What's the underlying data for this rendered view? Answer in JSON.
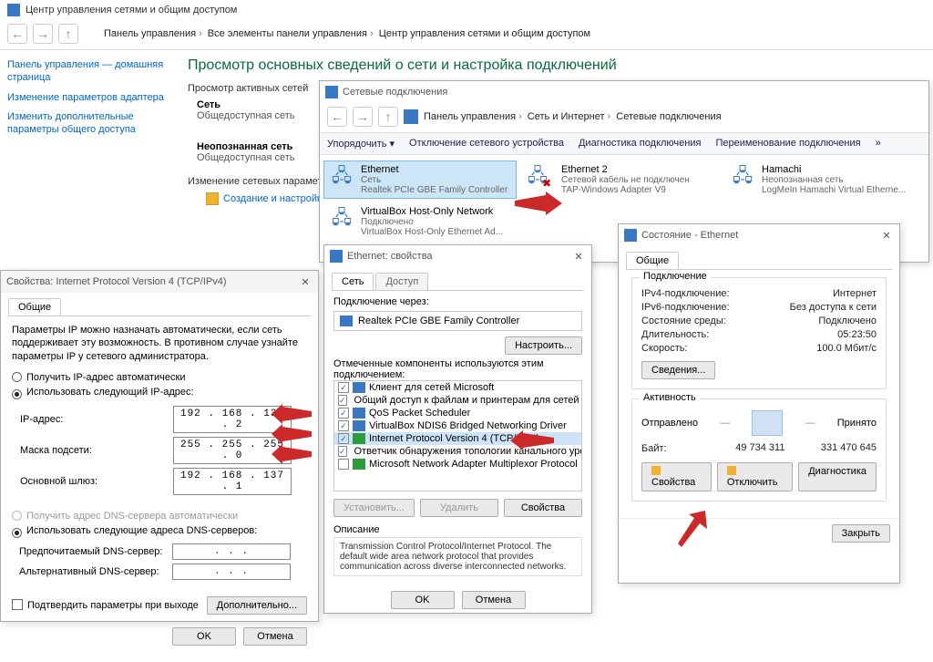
{
  "bg": {
    "title": "Центр управления сетями и общим доступом",
    "crumb1": "Панель управления",
    "crumb2": "Все элементы панели управления",
    "crumb3": "Центр управления сетями и общим доступом",
    "left_links": [
      "Панель управления — домашняя страница",
      "Изменение параметров адаптера",
      "Изменить дополнительные параметры общего доступа"
    ],
    "h2": "Просмотр основных сведений о сети и настройка подключений",
    "sub1": "Просмотр активных сетей",
    "net1_name": "Сеть",
    "net1_kind": "Общедоступная сеть",
    "net2_name": "Неопознанная сеть",
    "net2_kind": "Общедоступная сеть",
    "sub2": "Изменение сетевых параметров",
    "task": "Создание и настройка"
  },
  "nc": {
    "title": "Сетевые подключения",
    "crumb1": "Панель управления",
    "crumb2": "Сеть и Интернет",
    "crumb3": "Сетевые подключения",
    "tb": {
      "organize": "Упорядочить ▾",
      "disable": "Отключение сетевого устройства",
      "diag": "Диагностика подключения",
      "rename": "Переименование подключения",
      "more": "»"
    },
    "a1": {
      "name": "Ethernet",
      "s1": "Сеть",
      "s2": "Realtek PCIe GBE Family Controller"
    },
    "a2": {
      "name": "Ethernet 2",
      "s1": "Сетевой кабель не подключен",
      "s2": "TAP-Windows Adapter V9"
    },
    "a3": {
      "name": "Hamachi",
      "s1": "Неопознанная сеть",
      "s2": "LogMeIn Hamachi Virtual Etherne..."
    },
    "a4": {
      "name": "VirtualBox Host-Only Network",
      "s1": "Подключено",
      "s2": "VirtualBox Host-Only Ethernet Ad..."
    }
  },
  "st": {
    "title": "Состояние - Ethernet",
    "tab1": "Общие",
    "grp1": "Подключение",
    "ipv4_k": "IPv4-подключение:",
    "ipv4_v": "Интернет",
    "ipv6_k": "IPv6-подключение:",
    "ipv6_v": "Без доступа к сети",
    "media_k": "Состояние среды:",
    "media_v": "Подключено",
    "dur_k": "Длительность:",
    "dur_v": "05:23:50",
    "speed_k": "Скорость:",
    "speed_v": "100.0 Мбит/с",
    "details_btn": "Сведения...",
    "grp2": "Активность",
    "sent_lbl": "Отправлено",
    "recv_lbl": "Принято",
    "bytes_k": "Байт:",
    "sent_v": "49 734 311",
    "recv_v": "331 470 645",
    "props_btn": "Свойства",
    "disable_btn": "Отключить",
    "diag_btn": "Диагностика",
    "close_btn": "Закрыть"
  },
  "ep": {
    "title": "Ethernet: свойства",
    "tab_net": "Сеть",
    "tab_access": "Доступ",
    "conn_via": "Подключение через:",
    "adapter": "Realtek PCIe GBE Family Controller",
    "configure": "Настроить...",
    "marked": "Отмеченные компоненты используются этим подключением:",
    "items": [
      "Клиент для сетей Microsoft",
      "Общий доступ к файлам и принтерам для сетей M",
      "QoS Packet Scheduler",
      "VirtualBox NDIS6 Bridged Networking Driver",
      "Internet Protocol Version 4 (TCP/IPv4)",
      "Ответчик обнаружения топологии канального уров",
      "Microsoft Network Adapter Multiplexor Protocol"
    ],
    "install": "Установить...",
    "remove": "Удалить",
    "props": "Свойства",
    "desc_h": "Описание",
    "desc": "Transmission Control Protocol/Internet Protocol. The default wide area network protocol that provides communication across diverse interconnected networks.",
    "ok": "OK",
    "cancel": "Отмена"
  },
  "ip": {
    "title": "Свойства: Internet Protocol Version 4 (TCP/IPv4)",
    "tab": "Общие",
    "intro": "Параметры IP можно назначать автоматически, если сеть поддерживает эту возможность. В противном случае узнайте параметры IP у сетевого администратора.",
    "r_auto": "Получить IP-адрес автоматически",
    "r_manual": "Использовать следующий IP-адрес:",
    "ip_lbl": "IP-адрес:",
    "ip_val": "192 . 168 . 137 .  2",
    "mask_lbl": "Маска подсети:",
    "mask_val": "255 . 255 . 255 .  0",
    "gw_lbl": "Основной шлюз:",
    "gw_val": "192 . 168 . 137 .  1",
    "dns_auto": "Получить адрес DNS-сервера автоматически",
    "dns_manual": "Использовать следующие адреса DNS-серверов:",
    "dns1_lbl": "Предпочитаемый DNS-сервер:",
    "dns1_val": " .     .     . ",
    "dns2_lbl": "Альтернативный DNS-сервер:",
    "dns2_val": " .     .     . ",
    "confirm": "Подтвердить параметры при выходе",
    "adv": "Дополнительно...",
    "ok": "OK",
    "cancel": "Отмена"
  }
}
